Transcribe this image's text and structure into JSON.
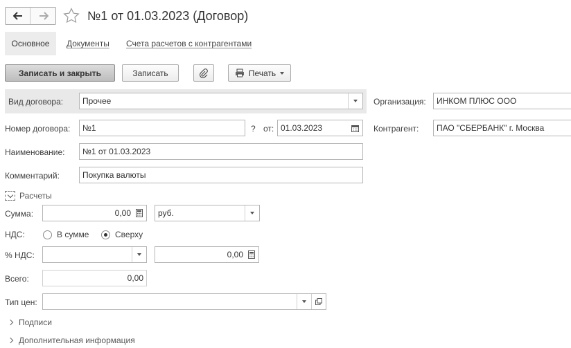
{
  "header": {
    "title": "№1 от 01.03.2023 (Договор)"
  },
  "tabs": [
    {
      "label": "Основное"
    },
    {
      "label": "Документы"
    },
    {
      "label": "Счета расчетов с контрагентами"
    }
  ],
  "toolbar": {
    "save_close_label": "Записать и закрыть",
    "save_label": "Записать",
    "print_label": "Печать"
  },
  "form": {
    "vid_label": "Вид договора:",
    "vid_value": "Прочее",
    "nomer_label": "Номер договора:",
    "nomer_value": "№1",
    "question_mark": "?",
    "ot_label": "от:",
    "date_value": "01.03.2023",
    "naim_label": "Наименование:",
    "naim_value": "№1 от 01.03.2023",
    "comment_label": "Комментарий:",
    "comment_value": "Покупка валюты",
    "org_label": "Организация:",
    "org_value": "ИНКОМ ПЛЮС ООО",
    "kontr_label": "Контрагент:",
    "kontr_value": "ПАО \"СБЕРБАНК\" г. Москва"
  },
  "raschety": {
    "section_label": "Расчеты",
    "summa_label": "Сумма:",
    "summa_value": "0,00",
    "currency_value": "руб.",
    "nds_label": "НДС:",
    "nds_option_1": "В сумме",
    "nds_option_2": "Сверху",
    "nds_selected": "Сверху",
    "nds_pct_label": "% НДС:",
    "nds_pct_value": "",
    "nds_amount_value": "0,00",
    "vsego_label": "Всего:",
    "vsego_value": "0,00",
    "tip_cen_label": "Тип цен:",
    "tip_cen_value": ""
  },
  "sections": {
    "podpisi": "Подписи",
    "dop_info": "Дополнительная информация"
  },
  "colors": {
    "active_tab_bg": "#ececec",
    "primary_button": "#c9c9c9",
    "field_border": "#b5b5b5"
  }
}
